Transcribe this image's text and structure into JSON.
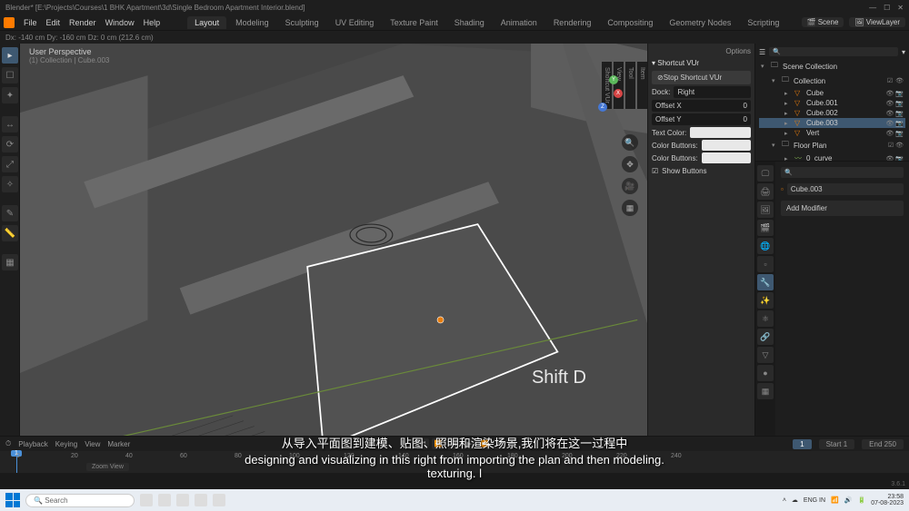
{
  "title": "Blender* [E:\\Projects\\Courses\\1 BHK Apartment\\3d\\Single Bedroom Apartment Interior.blend]",
  "window_controls": {
    "min": "—",
    "max": "☐",
    "close": "✕"
  },
  "menu": {
    "file": "File",
    "edit": "Edit",
    "render": "Render",
    "window": "Window",
    "help": "Help"
  },
  "workspace_tabs": [
    "Layout",
    "Modeling",
    "Sculpting",
    "UV Editing",
    "Texture Paint",
    "Shading",
    "Animation",
    "Rendering",
    "Compositing",
    "Geometry Nodes",
    "Scripting"
  ],
  "active_workspace": "Layout",
  "scene": "Scene",
  "viewlayer": "ViewLayer",
  "transform_status": "Dx: -140 cm   Dy: -160 cm   Dz: 0 cm (212.6 cm)",
  "viewport": {
    "header1": "User Perspective",
    "header2": "(1) Collection | Cube.003",
    "options_label": "Options"
  },
  "npanel": {
    "options": "Options",
    "title": "Shortcut VUr",
    "stop": "Stop Shortcut VUr",
    "dock_label": "Dock:",
    "dock_value": "Right",
    "offset_x_label": "Offset X",
    "offset_x": "0",
    "offset_y_label": "Offset Y",
    "offset_y": "0",
    "text_color_label": "Text Color:",
    "color_buttons_label": "Color Buttons:",
    "color_buttons_label2": "Color Buttons:",
    "show_buttons": "Show Buttons",
    "tabs": [
      "Item",
      "Tool",
      "View",
      "Shortcut VUr"
    ]
  },
  "outliner": {
    "root": "Scene Collection",
    "collection": "Collection",
    "items": [
      "Cube",
      "Cube.001",
      "Cube.002",
      "Cube.003",
      "Vert",
      "Floor Plan",
      "0_curve"
    ],
    "selected": "Cube.003"
  },
  "props": {
    "search_ph": "",
    "object": "Cube.003",
    "add_modifier": "Add Modifier"
  },
  "timeline": {
    "playback": "Playback",
    "keying": "Keying",
    "view": "View",
    "marker": "Marker",
    "ruler": [
      "0",
      "20",
      "40",
      "60",
      "80",
      "100",
      "120",
      "140",
      "160",
      "180",
      "200",
      "220",
      "240"
    ],
    "current": "1",
    "start_label": "Start",
    "start": "1",
    "end_label": "End",
    "end": "250",
    "zoom": "Zoom View"
  },
  "shortcut_overlay": "Shift D",
  "subtitles": {
    "cn": "从导入平面图到建模、贴图、照明和渲染场景,我们将在这一过程中",
    "en": "designing and visualizing in this right from importing the plan and then modeling. texturing. l"
  },
  "taskbar": {
    "search_ph": "Search",
    "lang": "ENG\nIN",
    "time": "23:58",
    "date": "07-08-2023"
  },
  "version": "3.6.1"
}
